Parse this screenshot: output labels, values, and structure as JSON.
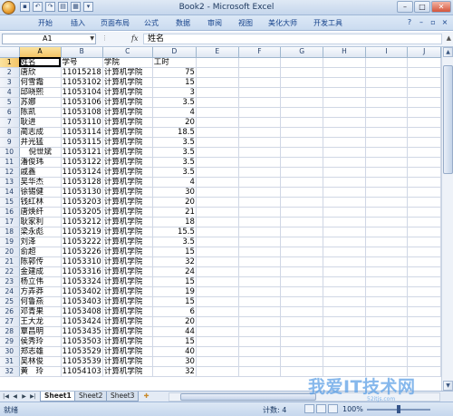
{
  "window": {
    "title": "Book2 - Microsoft Excel",
    "controls": [
      "–",
      "□",
      "✕"
    ]
  },
  "ribbon": {
    "tabs": [
      "开始",
      "插入",
      "页面布局",
      "公式",
      "数据",
      "审阅",
      "视图",
      "美化大师",
      "开发工具"
    ]
  },
  "formula_bar": {
    "name_box": "A1",
    "fx_label": "fx",
    "content": "姓名"
  },
  "columns": [
    "A",
    "B",
    "C",
    "D",
    "E",
    "F",
    "G",
    "H",
    "I",
    "J"
  ],
  "rows": [
    {
      "n": "1",
      "a": "姓名",
      "b": "学号",
      "c": "学院",
      "d": "工时",
      "d_num": false
    },
    {
      "n": "2",
      "a": "唐欣",
      "b": "11015218",
      "c": "计算机学院",
      "d": "75"
    },
    {
      "n": "3",
      "a": "何雪霜",
      "b": "11053102",
      "c": "计算机学院",
      "d": "15"
    },
    {
      "n": "4",
      "a": "邱晓熙",
      "b": "11053104",
      "c": "计算机学院",
      "d": "3"
    },
    {
      "n": "5",
      "a": "苏娜",
      "b": "11053106",
      "c": "计算机学院",
      "d": "3.5"
    },
    {
      "n": "6",
      "a": "陈凯",
      "b": "11053108",
      "c": "计算机学院",
      "d": "4"
    },
    {
      "n": "7",
      "a": "耿进",
      "b": "11053110",
      "c": "计算机学院",
      "d": "20"
    },
    {
      "n": "8",
      "a": "蔺志成",
      "b": "11053114",
      "c": "计算机学院",
      "d": "18.5"
    },
    {
      "n": "9",
      "a": "井光猛",
      "b": "11053115",
      "c": "计算机学院",
      "d": "3.5"
    },
    {
      "n": "10",
      "a": "倪世斌",
      "b": "11053121",
      "c": "计算机学院",
      "d": "3.5",
      "a_indent": true
    },
    {
      "n": "11",
      "a": "潘俊玮",
      "b": "11053122",
      "c": "计算机学院",
      "d": "3.5"
    },
    {
      "n": "12",
      "a": "戚鑫",
      "b": "11053124",
      "c": "计算机学院",
      "d": "3.5"
    },
    {
      "n": "13",
      "a": "吴华杰",
      "b": "11053128",
      "c": "计算机学院",
      "d": "4"
    },
    {
      "n": "14",
      "a": "徐锡健",
      "b": "11053130",
      "c": "计算机学院",
      "d": "30"
    },
    {
      "n": "15",
      "a": "钱红林",
      "b": "11053203",
      "c": "计算机学院",
      "d": "20"
    },
    {
      "n": "16",
      "a": "唐焕纤",
      "b": "11053205",
      "c": "计算机学院",
      "d": "21"
    },
    {
      "n": "17",
      "a": "耿家利",
      "b": "11053212",
      "c": "计算机学院",
      "d": "18"
    },
    {
      "n": "18",
      "a": "梁永彪",
      "b": "11053219",
      "c": "计算机学院",
      "d": "15.5"
    },
    {
      "n": "19",
      "a": "刘泽",
      "b": "11053222",
      "c": "计算机学院",
      "d": "3.5"
    },
    {
      "n": "20",
      "a": "俞超",
      "b": "11053226",
      "c": "计算机学院",
      "d": "15"
    },
    {
      "n": "21",
      "a": "陈郭传",
      "b": "11053310",
      "c": "计算机学院",
      "d": "32"
    },
    {
      "n": "22",
      "a": "金建成",
      "b": "11053316",
      "c": "计算机学院",
      "d": "24"
    },
    {
      "n": "23",
      "a": "杨立伟",
      "b": "11053324",
      "c": "计算机学院",
      "d": "15"
    },
    {
      "n": "24",
      "a": "方弄莽",
      "b": "11053402",
      "c": "计算机学院",
      "d": "19"
    },
    {
      "n": "25",
      "a": "何鲁燕",
      "b": "11053403",
      "c": "计算机学院",
      "d": "15"
    },
    {
      "n": "26",
      "a": "邓青果",
      "b": "11053408",
      "c": "计算机学院",
      "d": "6"
    },
    {
      "n": "27",
      "a": "王大龙",
      "b": "11053424",
      "c": "计算机学院",
      "d": "20"
    },
    {
      "n": "28",
      "a": "覃昌明",
      "b": "11053435",
      "c": "计算机学院",
      "d": "44"
    },
    {
      "n": "29",
      "a": "侯秀玲",
      "b": "11053503",
      "c": "计算机学院",
      "d": "15"
    },
    {
      "n": "30",
      "a": "郑志雄",
      "b": "11053529",
      "c": "计算机学院",
      "d": "40"
    },
    {
      "n": "31",
      "a": "吴林俊",
      "b": "11053539",
      "c": "计算机学院",
      "d": "30"
    },
    {
      "n": "32",
      "a": "黄　玲",
      "b": "11054103",
      "c": "计算机学院",
      "d": "32"
    }
  ],
  "sheets": [
    "Sheet1",
    "Sheet2",
    "Sheet3"
  ],
  "active_sheet": "Sheet1",
  "status": {
    "ready": "就绪",
    "count": "计数: 4",
    "zoom": "100%"
  },
  "watermark": {
    "text": "我爱IT技术网",
    "sub": "52itjs.com"
  }
}
